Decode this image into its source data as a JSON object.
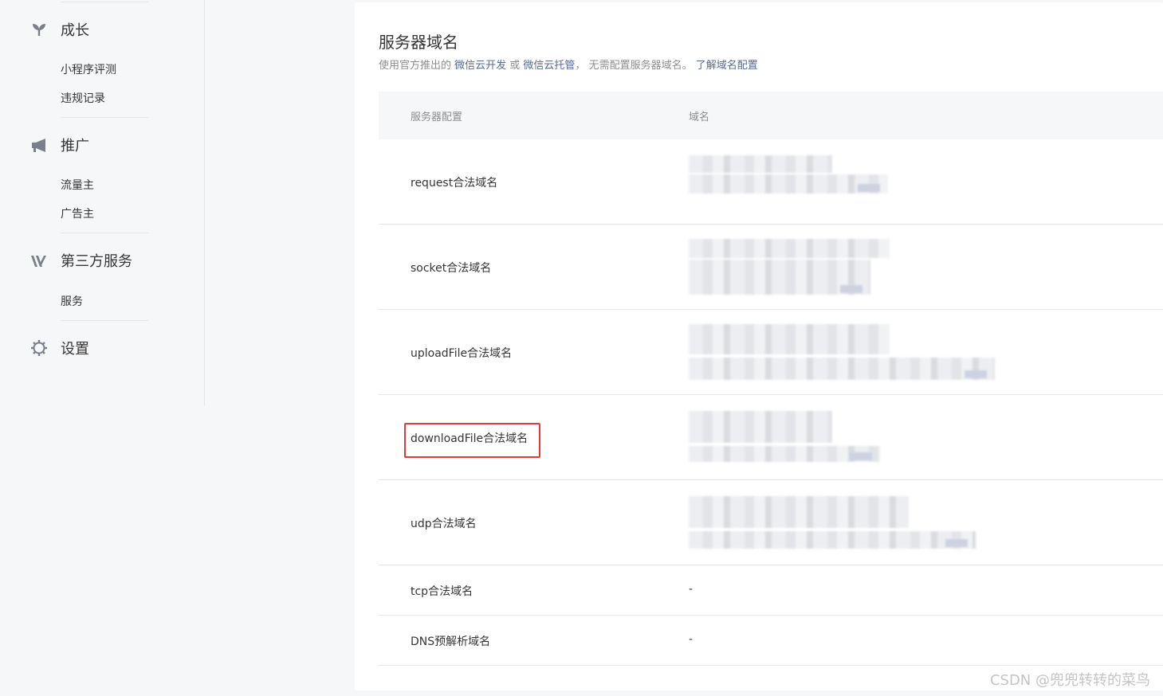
{
  "sidebar": {
    "groups": [
      {
        "title": "成长",
        "icon": "sprout-icon",
        "items": [
          "小程序评测",
          "违规记录"
        ]
      },
      {
        "title": "推广",
        "icon": "megaphone-icon",
        "items": [
          "流量主",
          "广告主"
        ]
      },
      {
        "title": "第三方服务",
        "icon": "third-party-icon",
        "items": [
          "服务"
        ]
      },
      {
        "title": "设置",
        "icon": "gear-icon",
        "items": []
      }
    ]
  },
  "main": {
    "title": "服务器域名",
    "desc": {
      "prefix": "使用官方推出的 ",
      "link1": "微信云开发",
      "mid": " 或 ",
      "link2": "微信云托管",
      "suffix": "， 无需配置服务器域名。 ",
      "link3": "了解域名配置"
    },
    "table": {
      "headers": [
        "服务器配置",
        "域名"
      ],
      "rows": [
        {
          "label": "request合法域名",
          "value": ""
        },
        {
          "label": "socket合法域名",
          "value": ""
        },
        {
          "label": "uploadFile合法域名",
          "value": ""
        },
        {
          "label": "downloadFile合法域名",
          "value": ""
        },
        {
          "label": "udp合法域名",
          "value": ""
        },
        {
          "label": "tcp合法域名",
          "value": "-"
        },
        {
          "label": "DNS预解析域名",
          "value": "-"
        }
      ]
    }
  },
  "watermark": "CSDN @兜兜转转的菜鸟",
  "colors": {
    "link": "#576b95",
    "highlight": "#e53935",
    "muted": "#8d8d8d"
  }
}
